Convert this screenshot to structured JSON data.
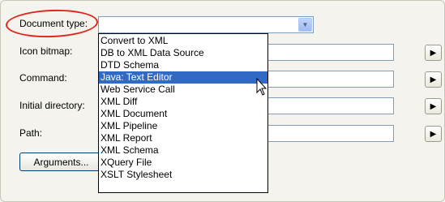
{
  "form": {
    "document_type_label": "Document type:",
    "icon_bitmap_label": "Icon bitmap:",
    "command_label": "Command:",
    "initial_directory_label": "Initial directory:",
    "path_label": "Path:",
    "arguments_button": "Arguments...",
    "document_type_value": ""
  },
  "dropdown": {
    "options": [
      "Convert to XML",
      "DB to XML Data Source",
      "DTD Schema",
      "Java: Text Editor",
      "Web Service Call",
      "XML Diff",
      "XML Document",
      "XML Pipeline",
      "XML Report",
      "XML Schema",
      "XQuery File",
      "XSLT Stylesheet"
    ],
    "highlighted_index": 3
  },
  "colors": {
    "highlight": "#316ac5",
    "annotation_circle": "#e1241c"
  },
  "icons": {
    "combo_arrow": "chevron-down-icon",
    "browse_arrow": "triangle-right-icon",
    "cursor": "mouse-pointer-icon"
  }
}
